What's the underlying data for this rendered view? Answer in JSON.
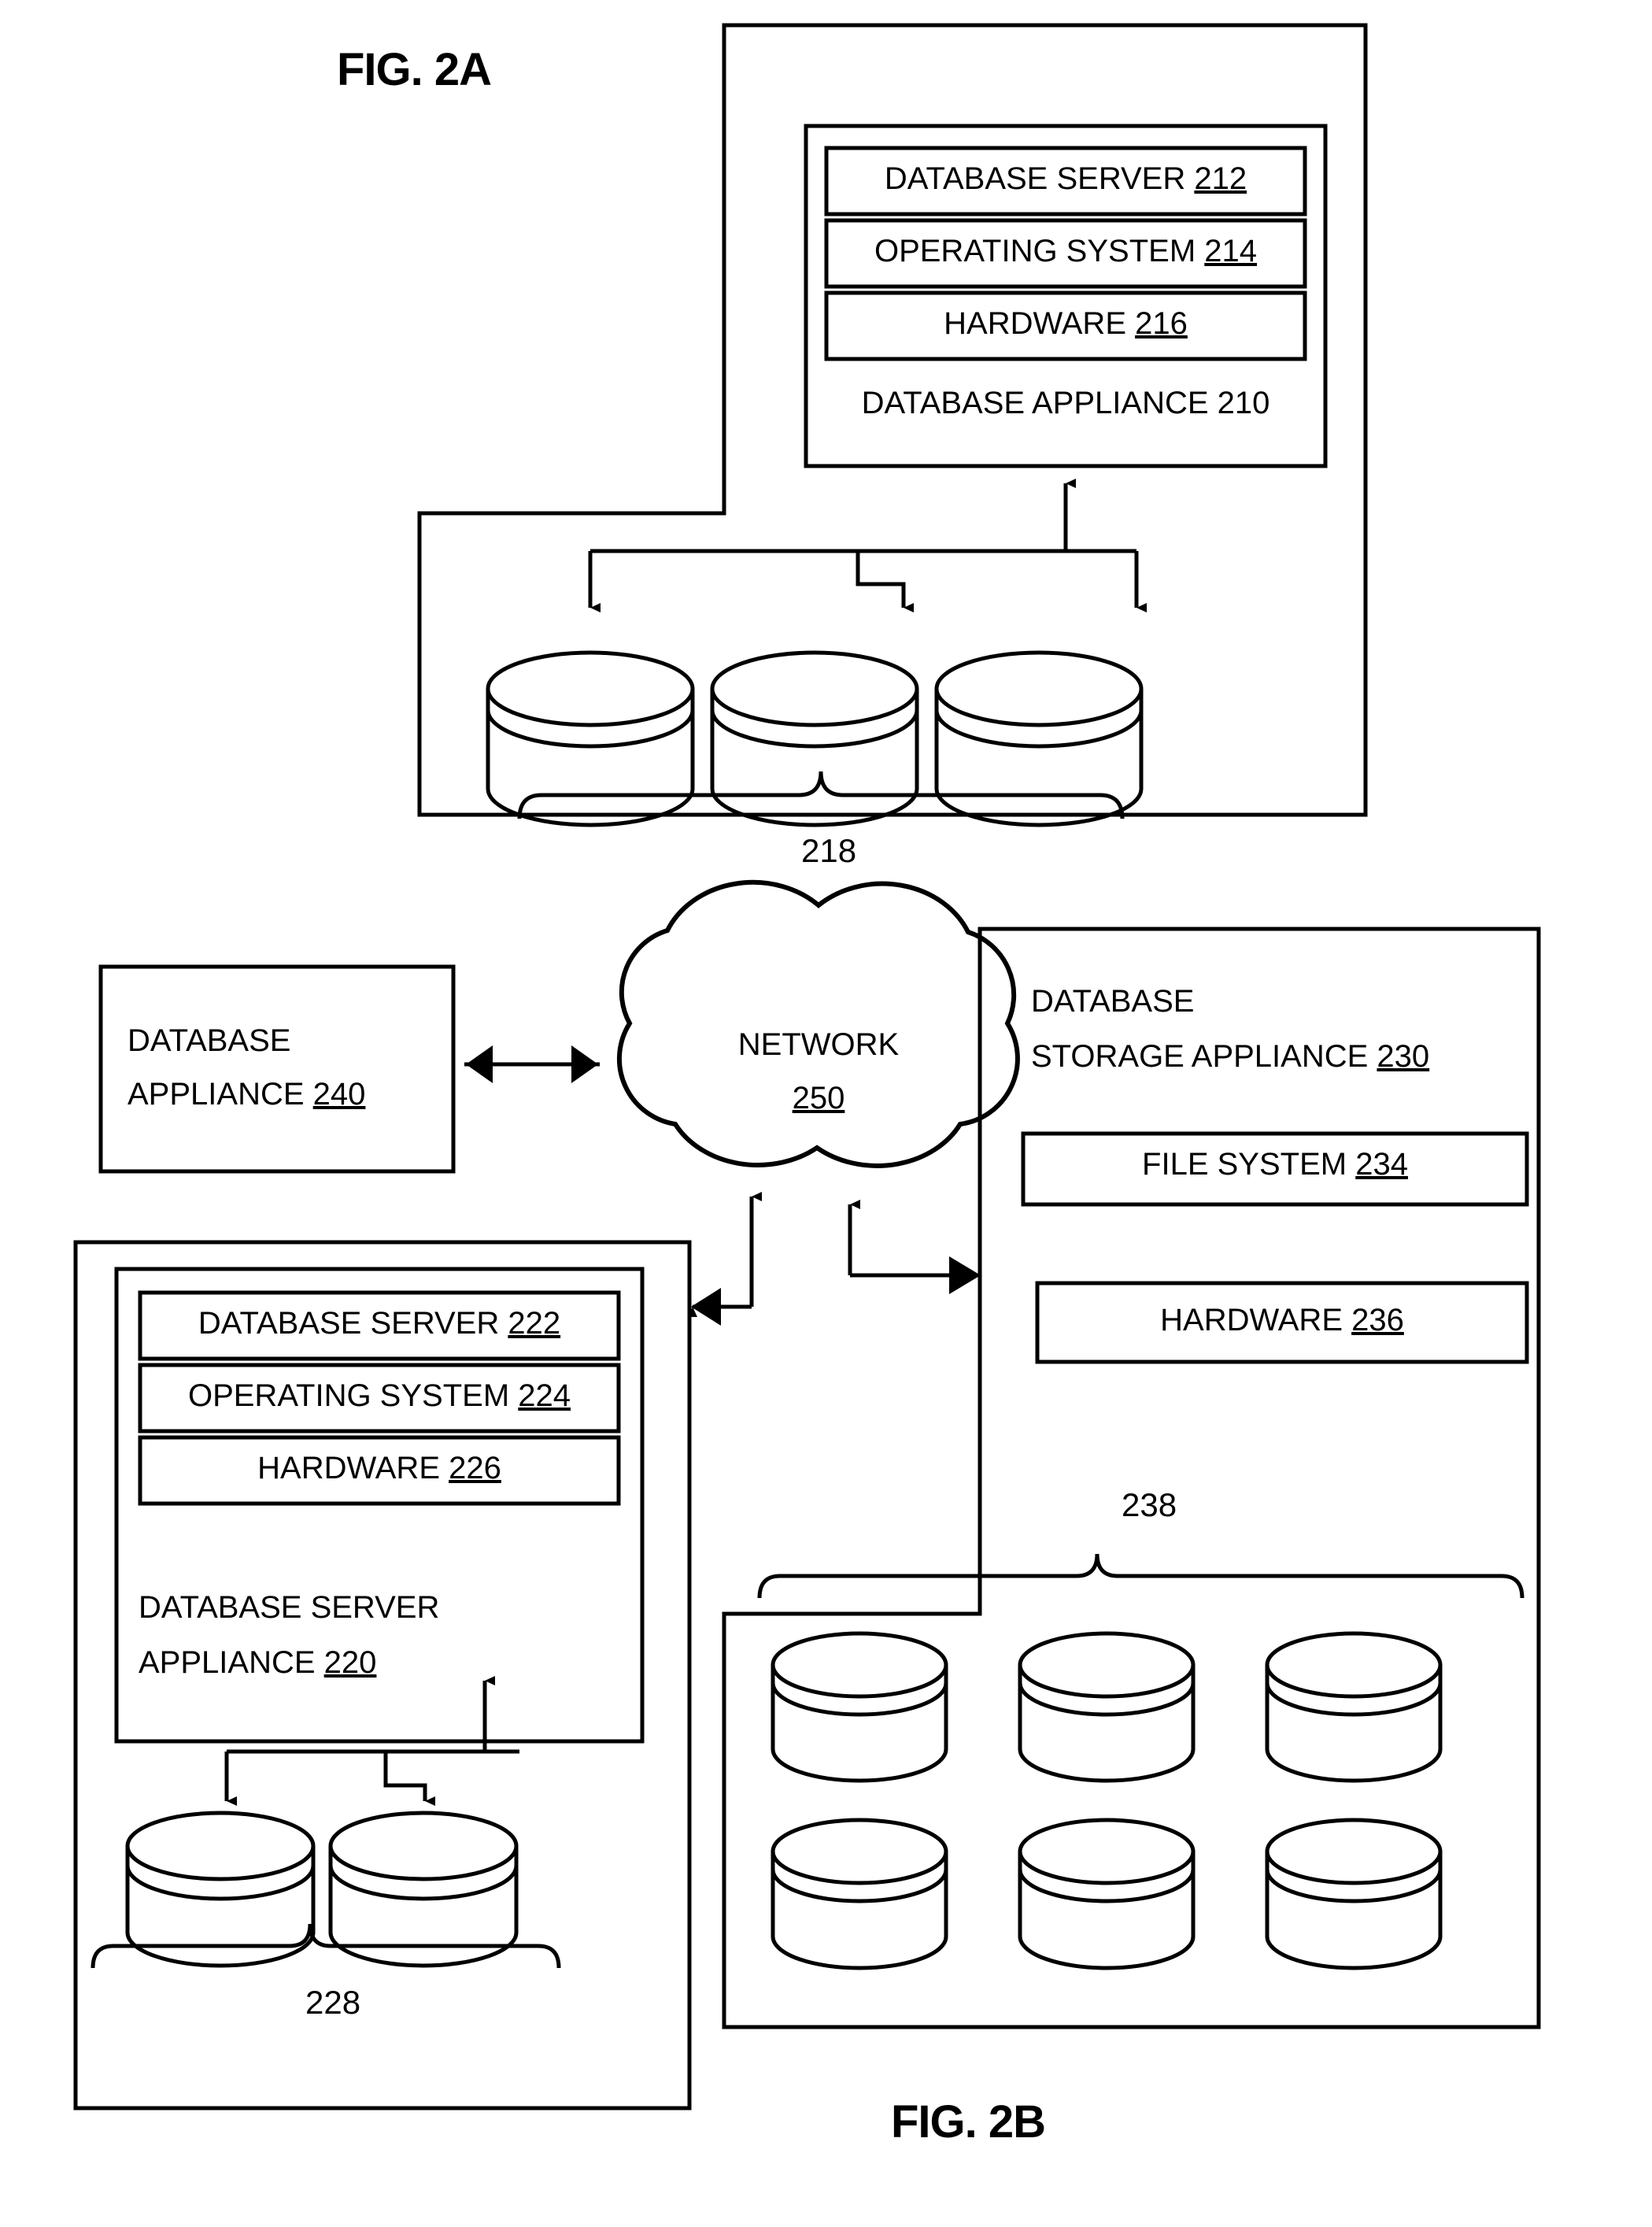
{
  "figures": {
    "fig_2a": {
      "label": "FIG. 2A",
      "appliance_title": "DATABASE APPLIANCE 210",
      "stack": [
        {
          "name": "DATABASE SERVER ",
          "ref": "212"
        },
        {
          "name": "OPERATING SYSTEM ",
          "ref": "214"
        },
        {
          "name": "HARDWARE ",
          "ref": "216"
        }
      ],
      "disk_group_ref": "218",
      "disk_count": 3
    },
    "fig_2b": {
      "label": "FIG. 2B",
      "database_appliance": {
        "line1": "DATABASE",
        "line2": "APPLIANCE ",
        "ref": "240"
      },
      "network": {
        "name": "NETWORK",
        "ref": "250"
      },
      "server_appliance": {
        "title_line1": "DATABASE  SERVER",
        "title_line2": "APPLIANCE ",
        "title_ref": "220",
        "stack": [
          {
            "name": "DATABASE SERVER ",
            "ref": "222"
          },
          {
            "name": "OPERATING SYSTEM ",
            "ref": "224"
          },
          {
            "name": "HARDWARE ",
            "ref": "226"
          }
        ],
        "disk_group_ref": "228",
        "disk_count": 2
      },
      "storage_appliance": {
        "title_line1": "DATABASE",
        "title_line2": "STORAGE APPLIANCE  ",
        "title_ref": "230",
        "stack": [
          {
            "name": "FILE SYSTEM ",
            "ref": "234"
          },
          {
            "name": "HARDWARE ",
            "ref": "236"
          }
        ],
        "disk_group_ref": "238",
        "disk_count": 6
      }
    }
  },
  "colors": {
    "ink": "#000000",
    "paper": "#ffffff"
  }
}
